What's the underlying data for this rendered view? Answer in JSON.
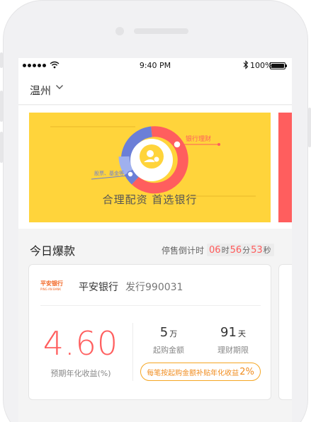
{
  "status_bar": {
    "time": "9:40 PM",
    "battery_percent": "100%",
    "battery_level": 1.0,
    "icons": [
      "signal-dots-icon",
      "wifi-icon",
      "bluetooth-icon",
      "battery-icon"
    ]
  },
  "nav": {
    "city": "温州",
    "city_dropdown_icon": "chevron-down-icon"
  },
  "banner": {
    "slogan": "合理配资  首选银行",
    "callout_right": "银行理财",
    "callout_left": "股票、基金等",
    "colors": {
      "background": "#ffd43b",
      "ring_primary": "#ff5e5e",
      "ring_secondary": "#6b7fd7",
      "next_slide": "#ff5e5e"
    }
  },
  "today": {
    "title": "今日爆款",
    "countdown_label": "停售倒计时",
    "countdown": {
      "hours": "06",
      "hours_unit": "时",
      "minutes": "56",
      "minutes_unit": "分",
      "seconds": "53",
      "seconds_unit": "秒"
    }
  },
  "product": {
    "bank_logo_text": "平安银行",
    "bank_logo_en": "PING AN BANK",
    "bank_name": "平安银行",
    "issue_code": "发行990031",
    "rate": "4.60",
    "rate_label": "预期年化收益(%)",
    "min_amount": "5",
    "min_amount_unit": "万",
    "min_amount_label": "起购金额",
    "term": "91",
    "term_unit": "天",
    "term_label": "理财期限",
    "subsidy_text": "每笔按起购金额补贴年化收益",
    "subsidy_pct": "2%",
    "colors": {
      "rate": "#ff5e5e",
      "subsidy_border": "#f5a623",
      "logo": "#f26522"
    }
  }
}
